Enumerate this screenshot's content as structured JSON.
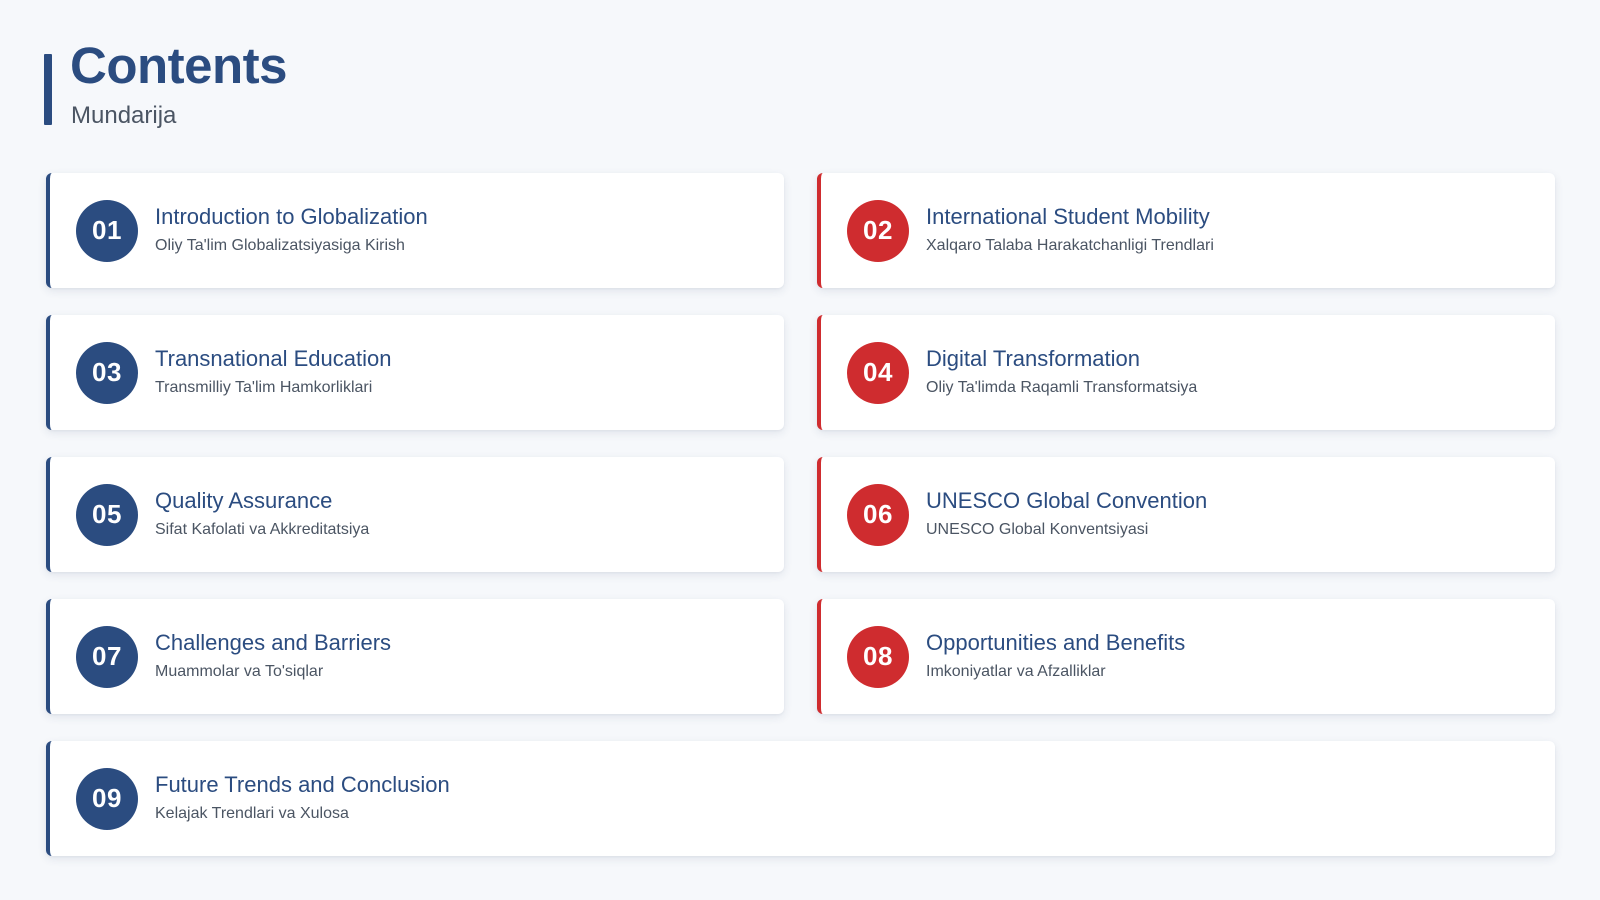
{
  "header": {
    "title": "Contents",
    "subtitle": "Mundarija"
  },
  "colors": {
    "navy": "#2b4c80",
    "red": "#cf2c2f",
    "background": "#f6f8fb"
  },
  "items": [
    {
      "number": "01",
      "title": "Introduction to Globalization",
      "subtitle": "Oliy Ta'lim Globalizatsiyasiga Kirish",
      "accent": "navy"
    },
    {
      "number": "02",
      "title": "International Student Mobility",
      "subtitle": "Xalqaro Talaba Harakatchanligi Trendlari",
      "accent": "red"
    },
    {
      "number": "03",
      "title": "Transnational Education",
      "subtitle": "Transmilliy Ta'lim Hamkorliklari",
      "accent": "navy"
    },
    {
      "number": "04",
      "title": "Digital Transformation",
      "subtitle": "Oliy Ta'limda Raqamli Transformatsiya",
      "accent": "red"
    },
    {
      "number": "05",
      "title": "Quality Assurance",
      "subtitle": "Sifat Kafolati va Akkreditatsiya",
      "accent": "navy"
    },
    {
      "number": "06",
      "title": "UNESCO Global Convention",
      "subtitle": "UNESCO Global Konventsiyasi",
      "accent": "red"
    },
    {
      "number": "07",
      "title": "Challenges and Barriers",
      "subtitle": "Muammolar va To'siqlar",
      "accent": "navy"
    },
    {
      "number": "08",
      "title": "Opportunities and Benefits",
      "subtitle": "Imkoniyatlar va Afzalliklar",
      "accent": "red"
    },
    {
      "number": "09",
      "title": "Future Trends and Conclusion",
      "subtitle": "Kelajak Trendlari va Xulosa",
      "accent": "navy"
    }
  ]
}
